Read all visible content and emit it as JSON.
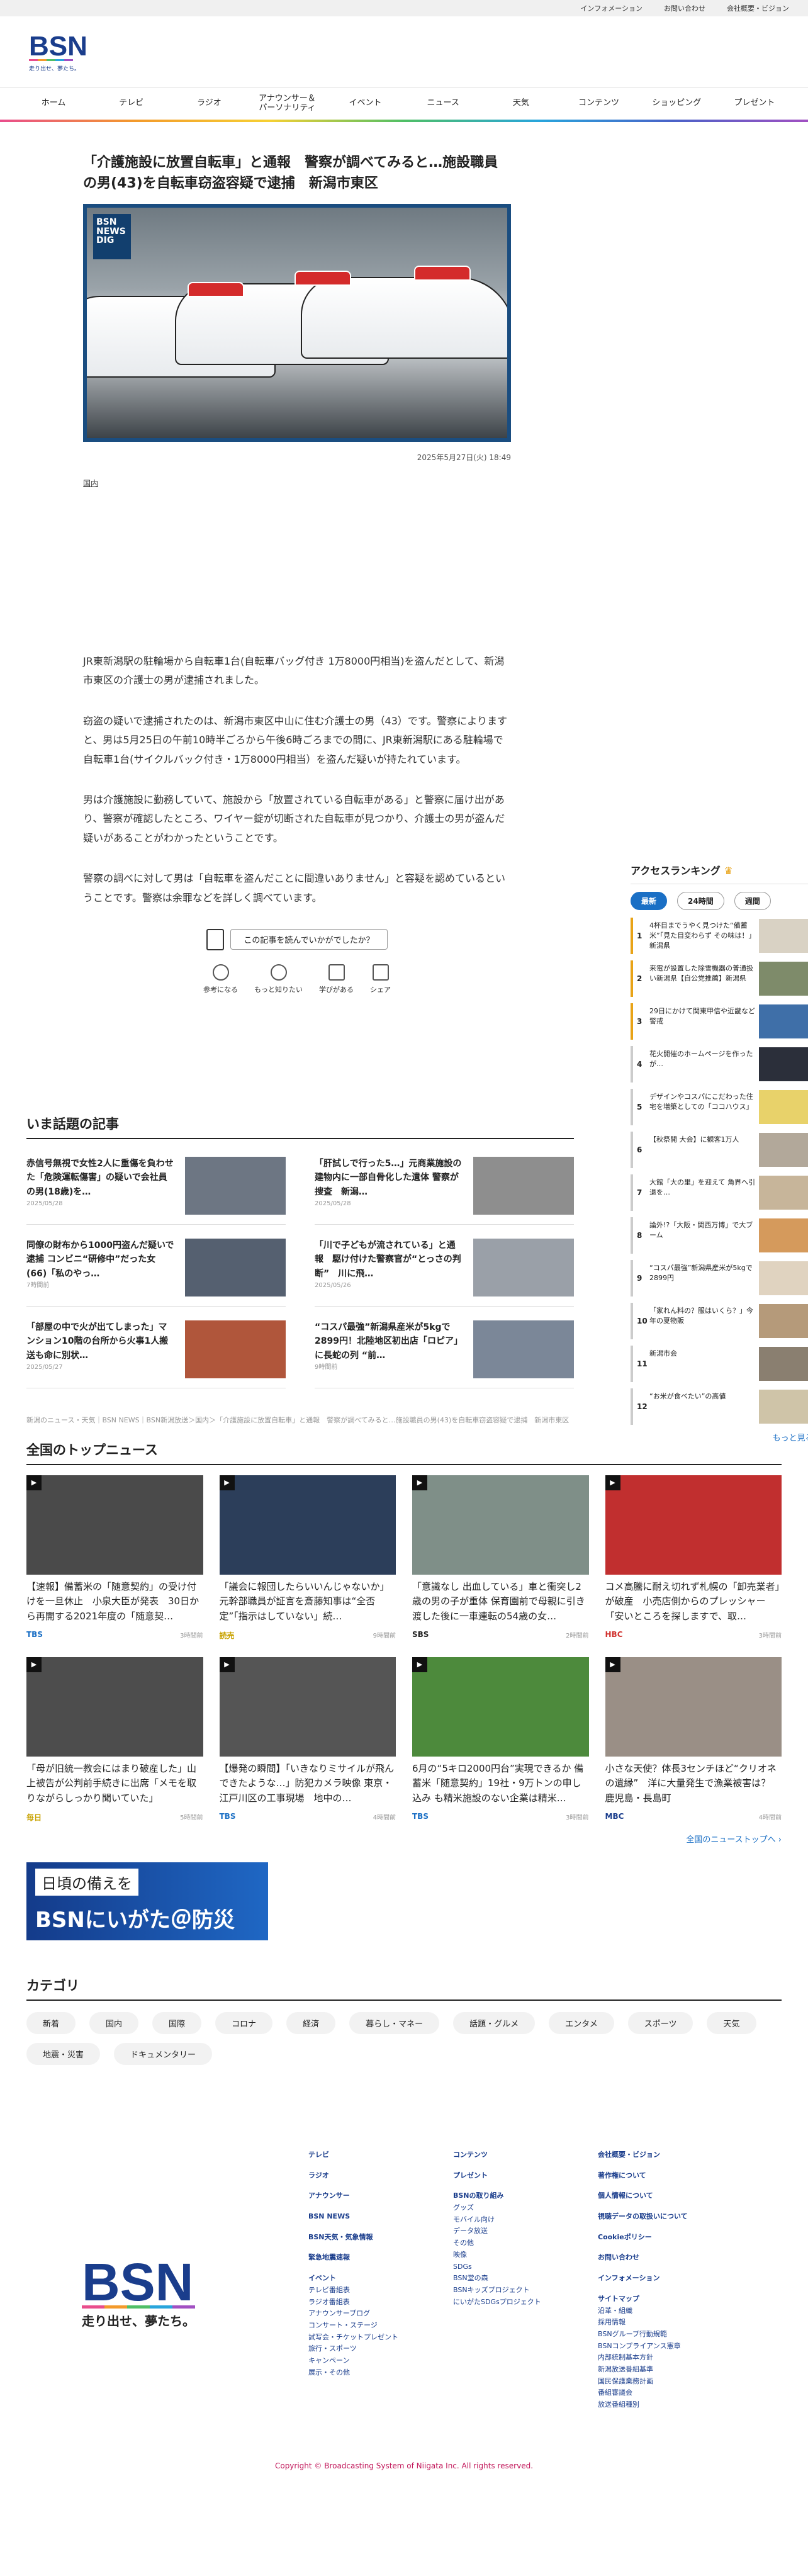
{
  "topbar": {
    "links": [
      "インフォメーション",
      "お問い合わせ",
      "会社概要・ビジョン"
    ]
  },
  "logo": {
    "text": "BSN",
    "tagline": "走り出せ、夢たち。"
  },
  "nav": [
    "ホーム",
    "テレビ",
    "ラジオ",
    "アナウンサー＆\nパーソナリティ",
    "イベント",
    "ニュース",
    "天気",
    "コンテンツ",
    "ショッピング",
    "プレゼント"
  ],
  "article": {
    "title": "「介護施設に放置自転車」と通報　警察が調べてみると…施設職員の男(43)を自転車窃盗容疑で逮捕　新潟市東区",
    "badge": "BSN NEWS DIG",
    "date": "2025年5月27日(火) 18:49",
    "category": "国内",
    "paragraphs": [
      "JR東新潟駅の駐輪場から自転車1台(自転車バッグ付き 1万8000円相当)を盗んだとして、新潟市東区の介護士の男が逮捕されました。",
      "窃盗の疑いで逮捕されたのは、新潟市東区中山に住む介護士の男（43）です。警察によりますと、男は5月25日の午前10時半ごろから午後6時ごろまでの間に、JR東新潟駅にある駐輪場で自転車1台(サイクルバック付き・1万8000円相当）を盗んだ疑いが持たれています。",
      "男は介護施設に勤務していて、施設から「放置されている自転車がある」と警察に届け出があり、警察が確認したところ、ワイヤー錠が切断された自転車が見つかり、介護士の男が盗んだ疑いがあることがわかったということです。",
      "警察の調べに対して男は「自転車を盗んだことに間違いありません」と容疑を認めているということです。警察は余罪などを詳しく調べています。"
    ],
    "feedback_q": "この記事を読んでいかがでしたか？",
    "feedback_btns": [
      "参考になる",
      "もっと知りたい",
      "学びがある",
      "シェア"
    ]
  },
  "hot": {
    "heading": "いま話題の記事",
    "items": [
      {
        "text": "赤信号無視で女性2人に重傷を負わせた「危険運転傷害」の疑いで会社員の男(18歳)を…",
        "date": "2025/05/28"
      },
      {
        "text": "「肝試しで行った5…」元商業施設の建物内に一部自骨化した遺体 警察が捜査　新潟…",
        "date": "2025/05/28"
      },
      {
        "text": "同僚の財布から1000円盗んだ疑いで逮捕 コンビニ“研修中”だった女(66)「私のやっ…",
        "date": "7時間前"
      },
      {
        "text": "「川で子どもが流されている」と通報　駆け付けた警察官が“とっさの判断”　川に飛…",
        "date": "2025/05/26"
      },
      {
        "text": "「部屋の中で火が出てしまった」マンション10階の台所から火事1人搬送も命に別状…",
        "date": "2025/05/27"
      },
      {
        "text": "“コスパ最強”新潟県産米が5kgで2899円！北陸地区初出店「ロピア」に長蛇の列 “前…",
        "date": "9時間前"
      }
    ]
  },
  "breadcrumb": "新潟のニュース・天気｜BSN NEWS｜BSN新潟放送＞国内＞「介護施設に放置自転車」と通報　警察が調べてみると…施設職員の男(43)を自転車窃盗容疑で逮捕　新潟市東区",
  "national": {
    "heading": "全国のトップニュース",
    "items": [
      {
        "text": "【速報】備蓄米の「随意契約」の受け付けを一旦休止　小泉大臣が発表　30日から再開する2021年度の「随意契…",
        "src": "TBS",
        "time": "3時間前"
      },
      {
        "text": "「議会に報団したらいいんじゃないか」元幹部職員が証言を斎藤知事は“全否定”「指示はしていない」続…",
        "src": "読売",
        "time": "9時間前"
      },
      {
        "text": "「意識なし 出血している」車と衝突し2歳の男の子が重体 保育園前で母親に引き渡した後に一車連転の54歳の女…",
        "src": "SBS",
        "time": "2時間前"
      },
      {
        "text": "コメ高騰に耐え切れず札幌の「卸売業者」が破産　小売店側からのプレッシャー「安いところを探しますで、取…",
        "src": "HBC",
        "time": "3時間前"
      },
      {
        "text": "「母が旧統一教会にはまり破産した」山上被告が公判前手続きに出席「メモを取りながらしっかり聞いていた」",
        "src": "毎日",
        "time": "5時間前"
      },
      {
        "text": "【爆発の瞬間】「いきなりミサイルが飛んできたような…」防犯カメラ映像 東京・江戸川区の工事現場　地中の…",
        "src": "TBS",
        "time": "4時間前"
      },
      {
        "text": "6月の“5キロ2000円台”実現できるか 備蓄米「随意契約」19社・9万トンの申し込み も精米施設のない企業は精米…",
        "src": "TBS",
        "time": "3時間前"
      },
      {
        "text": "小さな天使？体長3センチほど“クリオネの遺縁”　洋に大量発生で漁業被害は？　鹿児島・長島町",
        "src": "MBC",
        "time": "4時間前"
      }
    ],
    "more": "全国のニューストップへ ›"
  },
  "bosai": {
    "top": "日頃の備えを",
    "main": "BSNにいがた＠防災"
  },
  "category": {
    "heading": "カテゴリ",
    "tags": [
      "新着",
      "国内",
      "国際",
      "コロナ",
      "経済",
      "暮らし・マネー",
      "話題・グルメ",
      "エンタメ",
      "スポーツ",
      "天気",
      "地震・災害",
      "ドキュメンタリー"
    ]
  },
  "ranking": {
    "heading": "アクセスランキング",
    "tabs": [
      "最新",
      "24時間",
      "週間"
    ],
    "items": [
      "4杯目までうやく見つけた“備蓄米”「見た目変わらず その味は！」新潟県",
      "来電が設置した除雪機器の普通扱い新潟県【自公党推薦】新潟県",
      "29日にかけて関東甲信や近畿など警戒",
      "花火開催のホームページを作ったが…",
      "デザインやコスパにこだわった住宅を増築としての「ココハウス」",
      "【秋祭開 大会】に観客1万人",
      "大館「大の里」を迎えて 角界へ引退を…",
      "論外!?「大阪・関西万博」で大ブーム",
      "“コスパ最強”新潟県産米が5kgで2899円",
      "「家れん料の？服はいくら？」今年の夏物販",
      "新潟市会",
      "“お米が食べたい”の高値"
    ],
    "more": "もっと見る ›"
  },
  "footer": {
    "cols": [
      {
        "heads": [
          "テレビ",
          "ラジオ",
          "アナウンサー",
          "BSN NEWS",
          "BSN天気・気象情報",
          "緊急地震速報",
          "イベント"
        ],
        "items": [
          "テレビ番組表",
          "ラジオ番組表",
          "アナウンサーブログ",
          "コンサート・ステージ",
          "試写会・チケットプレゼント",
          "旅行・スポーツ",
          "キャンペーン",
          "展示・その他"
        ]
      },
      {
        "heads": [
          "コンテンツ",
          "プレゼント",
          "BSNの取り組み"
        ],
        "items": [
          "グッズ",
          "モバイル向け",
          "データ放送",
          "その他",
          "映像",
          "SDGs",
          "BSN堂の森",
          "BSNキッズプロジェクト",
          "にいがたSDGsプロジェクト"
        ]
      },
      {
        "heads": [
          "会社概要・ビジョン",
          "著作権について",
          "個人情報について",
          "視聴データの取扱いについて",
          "Cookieポリシー",
          "お問い合わせ",
          "インフォメーション",
          "サイトマップ"
        ],
        "items": [
          "沿革・組織",
          "採用情報",
          "BSNグループ行動規範",
          "BSNコンプライアンス憲章",
          "内部統制基本方針",
          "新潟放送番組基準",
          "国民保護業務計画",
          "番組審議会",
          "放送番組種別"
        ]
      }
    ],
    "copyright": "Copyright © Broadcasting System of Niigata Inc. All rights reserved."
  },
  "colors": {
    "accent": "#1a6fc5",
    "brand_blue": "#1a3d8c"
  }
}
